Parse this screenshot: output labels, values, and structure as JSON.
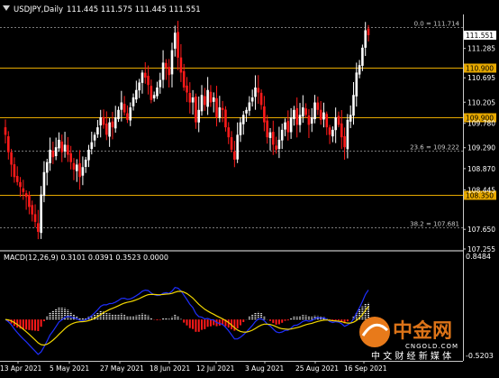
{
  "window": {
    "title": "USDJPY,Daily",
    "ohlc": "111.445 111.575 111.445 111.551",
    "menu_icon": "triangle-down-icon"
  },
  "colors": {
    "background": "#000000",
    "axis": "#c8c8c8",
    "bull_candle": "#ffffff",
    "bear_candle": "#ff1a1a",
    "level_line": "#e6a800",
    "fib_line": "#7a7a7a",
    "macd_line": "#1f2fff",
    "signal_line": "#f2d700",
    "histogram": "#ffffff",
    "bear_histogram": "#ff1a1a",
    "price_label_bg": "#e6a800",
    "current_price_bg": "#ffffff"
  },
  "chart_data": {
    "type": "candlestick",
    "symbol": "USDJPY",
    "timeframe": "Daily",
    "ylim": [
      107.255,
      111.95
    ],
    "y_ticks": [
      "111.285",
      "110.695",
      "110.205",
      "109.780",
      "109.290",
      "108.870",
      "108.445",
      "107.650",
      "107.255"
    ],
    "x_ticks": [
      "13 Apr 2021",
      "5 May 2021",
      "27 May 2021",
      "18 Jun 2021",
      "12 Jul 2021",
      "3 Aug 2021",
      "25 Aug 2021",
      "16 Sep 2021"
    ],
    "current_price": "111.551",
    "levels": [
      {
        "label": "110.900",
        "value": 110.9
      },
      {
        "label": "109.900",
        "value": 109.9
      },
      {
        "label": "108.350",
        "value": 108.35
      }
    ],
    "fib_levels": [
      {
        "label": "0.0 = 111.714",
        "value": 111.714
      },
      {
        "label": "23.6 = 109.222",
        "value": 109.222
      },
      {
        "label": "38.2 = 107.681",
        "value": 107.681
      }
    ],
    "closes": [
      109.55,
      109.2,
      108.95,
      108.7,
      108.6,
      108.5,
      108.4,
      108.3,
      108.1,
      107.95,
      107.8,
      107.6,
      108.35,
      108.8,
      109.0,
      109.25,
      109.1,
      109.3,
      109.45,
      109.2,
      109.35,
      109.15,
      109.0,
      108.85,
      108.95,
      108.7,
      108.9,
      109.05,
      109.25,
      109.4,
      109.55,
      109.7,
      109.9,
      109.75,
      109.55,
      109.8,
      109.7,
      109.9,
      110.05,
      110.2,
      110.0,
      109.85,
      110.1,
      110.3,
      110.45,
      110.6,
      110.8,
      110.7,
      110.55,
      110.25,
      110.35,
      110.5,
      110.65,
      111.0,
      110.9,
      110.75,
      111.25,
      111.6,
      111.1,
      110.8,
      110.5,
      110.4,
      110.2,
      110.3,
      109.8,
      110.05,
      110.35,
      110.15,
      110.45,
      110.2,
      110.3,
      109.9,
      110.1,
      110.05,
      109.7,
      109.5,
      109.25,
      109.05,
      109.55,
      109.8,
      109.95,
      110.05,
      110.2,
      110.3,
      110.5,
      110.4,
      110.15,
      109.8,
      109.5,
      109.6,
      109.35,
      109.25,
      109.45,
      109.65,
      109.8,
      109.6,
      109.9,
      110.05,
      109.75,
      109.95,
      110.1,
      109.95,
      109.75,
      109.9,
      110.2,
      110.05,
      109.85,
      110.0,
      109.7,
      109.55,
      109.65,
      109.9,
      109.75,
      109.5,
      109.3,
      109.85,
      109.95,
      110.35,
      110.8,
      110.95,
      111.3,
      111.65,
      111.551
    ],
    "macd_params": "MACD(12,26,9)",
    "macd_values": [
      "0.3101",
      "0.0391",
      "0.3523",
      "0.0000"
    ],
    "macd_ylim": [
      -0.5203,
      0.8484
    ],
    "macd_axis_labels": [
      "0.8484",
      "-0.5203"
    ]
  },
  "watermark": {
    "logo_text": "中金网",
    "url_text": "CNGOLD.COM",
    "tagline": "中 文 财 经 新 媒 体"
  }
}
